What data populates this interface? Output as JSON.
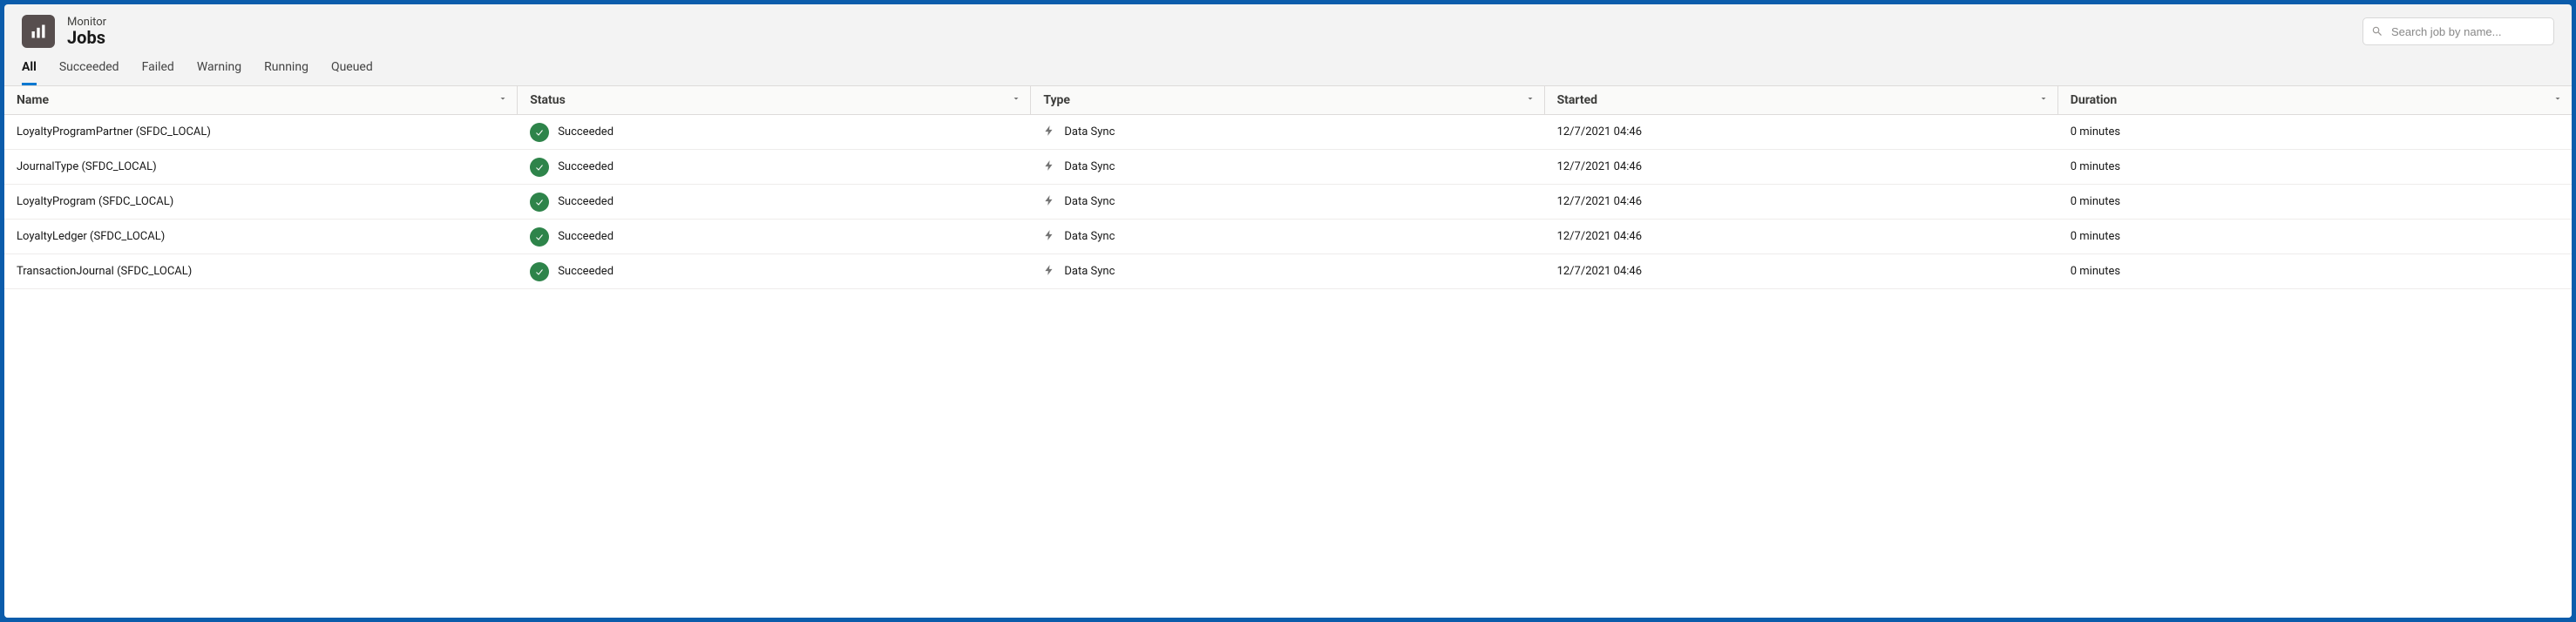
{
  "header": {
    "eyebrow": "Monitor",
    "title": "Jobs"
  },
  "search": {
    "placeholder": "Search job by name..."
  },
  "tabs": [
    {
      "label": "All",
      "active": true
    },
    {
      "label": "Succeeded",
      "active": false
    },
    {
      "label": "Failed",
      "active": false
    },
    {
      "label": "Warning",
      "active": false
    },
    {
      "label": "Running",
      "active": false
    },
    {
      "label": "Queued",
      "active": false
    }
  ],
  "columns": {
    "name": "Name",
    "status": "Status",
    "type": "Type",
    "started": "Started",
    "duration": "Duration"
  },
  "rows": [
    {
      "name": "LoyaltyProgramPartner (SFDC_LOCAL)",
      "status": "Succeeded",
      "type": "Data Sync",
      "started": "12/7/2021 04:46",
      "duration": "0 minutes"
    },
    {
      "name": "JournalType (SFDC_LOCAL)",
      "status": "Succeeded",
      "type": "Data Sync",
      "started": "12/7/2021 04:46",
      "duration": "0 minutes"
    },
    {
      "name": "LoyaltyProgram (SFDC_LOCAL)",
      "status": "Succeeded",
      "type": "Data Sync",
      "started": "12/7/2021 04:46",
      "duration": "0 minutes"
    },
    {
      "name": "LoyaltyLedger (SFDC_LOCAL)",
      "status": "Succeeded",
      "type": "Data Sync",
      "started": "12/7/2021 04:46",
      "duration": "0 minutes"
    },
    {
      "name": "TransactionJournal (SFDC_LOCAL)",
      "status": "Succeeded",
      "type": "Data Sync",
      "started": "12/7/2021 04:46",
      "duration": "0 minutes"
    }
  ]
}
